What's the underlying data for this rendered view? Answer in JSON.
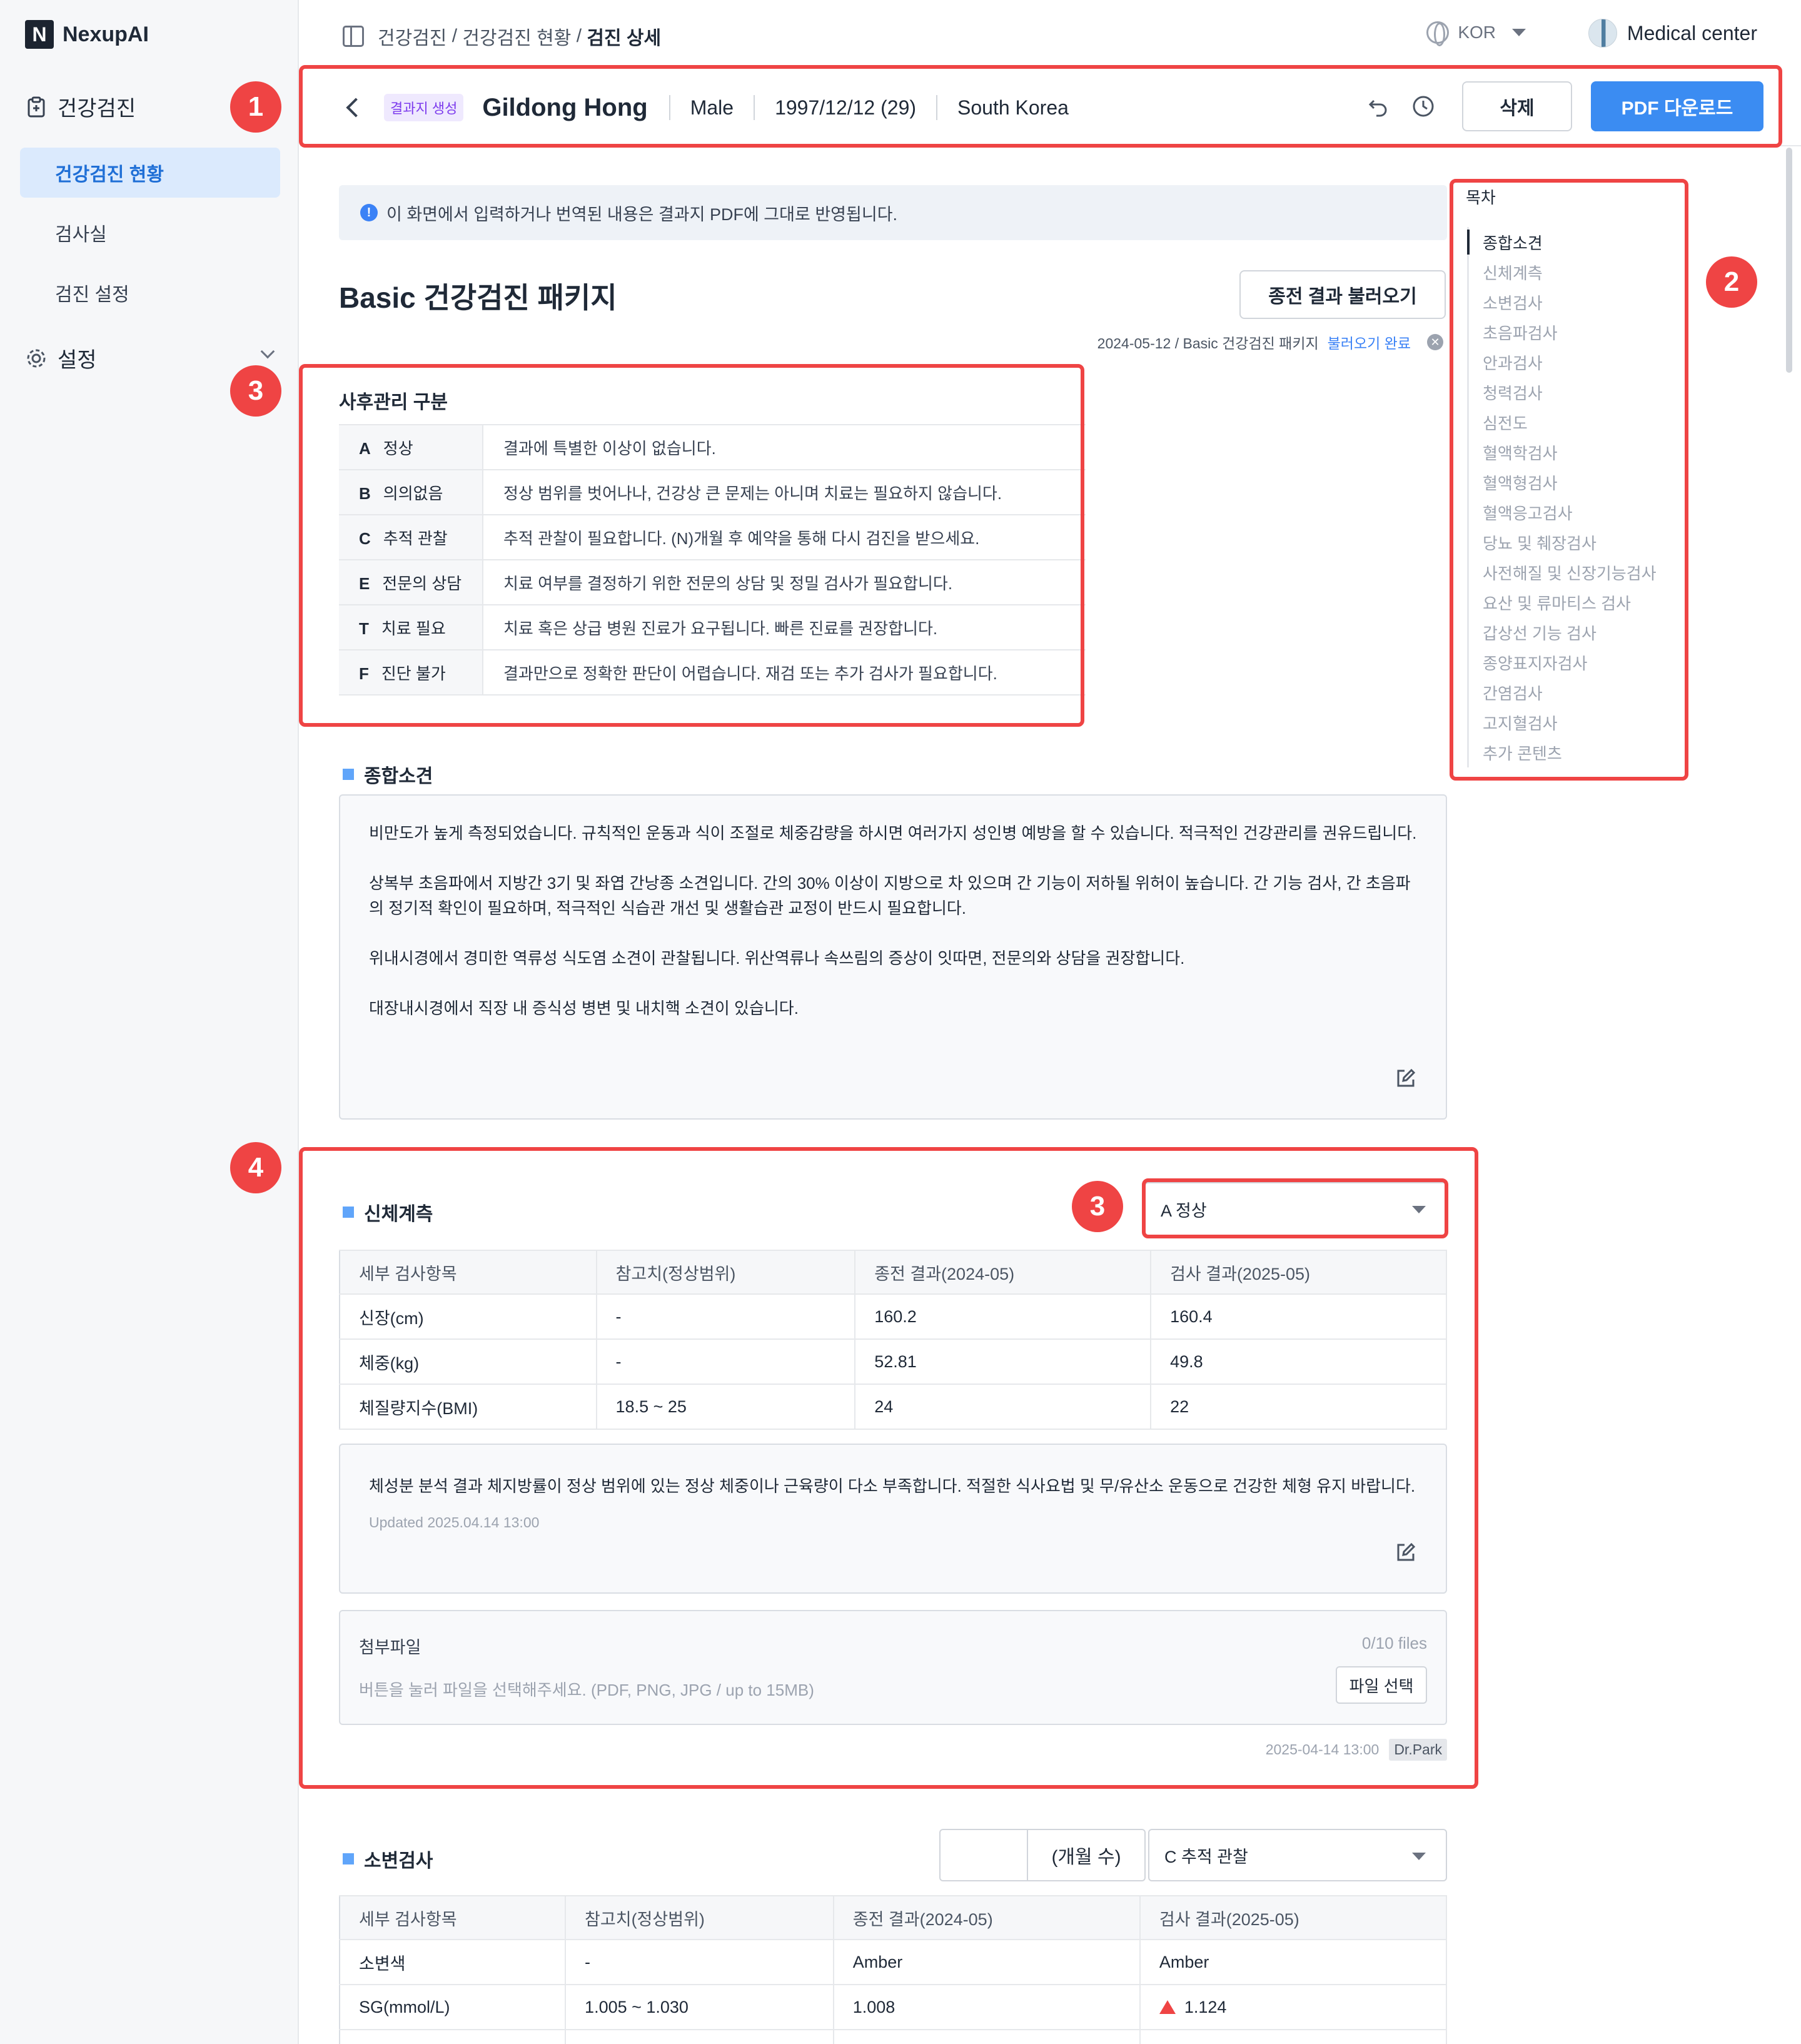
{
  "app": {
    "brand": "NexupAI",
    "brand_logo": "N"
  },
  "sidebar": {
    "group_health": "건강검진",
    "items": [
      {
        "label": "건강검진 현황",
        "active": true
      },
      {
        "label": "검사실"
      },
      {
        "label": "검진 설정"
      }
    ],
    "group_settings": "설정"
  },
  "topbar": {
    "breadcrumb": [
      "건강검진",
      "건강검진 현황",
      "검진 상세"
    ],
    "breadcrumb_sep": " / ",
    "language": "KOR",
    "center_name": "Medical center"
  },
  "patient": {
    "status_badge": "결과지 생성",
    "name": "Gildong Hong",
    "gender": "Male",
    "birth": "1997/12/12 (29)",
    "country": "South Korea",
    "delete_label": "삭제",
    "pdf_label": "PDF 다운로드"
  },
  "notice": "이 화면에서 입력하거나 번역된 내용은 결과지 PDF에 그대로 반영됩니다.",
  "package": {
    "title": "Basic 건강검진 패키지",
    "load_prev_label": "종전 결과 불러오기",
    "prev_meta": "2024-05-12 / Basic 건강검진 패키지",
    "prev_status": "불러오기 완료"
  },
  "legend": {
    "title": "사후관리 구분",
    "rows": [
      {
        "code": "A",
        "label": "정상",
        "desc": "결과에 특별한 이상이 없습니다."
      },
      {
        "code": "B",
        "label": "의의없음",
        "desc": "정상 범위를 벗어나나, 건강상 큰 문제는 아니며 치료는 필요하지 않습니다."
      },
      {
        "code": "C",
        "label": "추적 관찰",
        "desc": "추적 관찰이 필요합니다. (N)개월 후 예약을 통해 다시 검진을 받으세요."
      },
      {
        "code": "E",
        "label": "전문의 상담",
        "desc": "치료 여부를 결정하기 위한 전문의 상담 및 정밀 검사가 필요합니다."
      },
      {
        "code": "T",
        "label": "치료 필요",
        "desc": "치료 혹은 상급 병원 진료가 요구됩니다. 빠른 진료를 권장합니다."
      },
      {
        "code": "F",
        "label": "진단 불가",
        "desc": "결과만으로 정확한 판단이 어렵습니다. 재검 또는 추가 검사가 필요합니다."
      }
    ]
  },
  "summary": {
    "title": "종합소견",
    "paragraphs": [
      "비만도가 높게 측정되었습니다. 규칙적인 운동과 식이 조절로 체중감량을 하시면 여러가지 성인병 예방을 할 수 있습니다. 적극적인 건강관리를 권유드립니다.",
      "상복부 초음파에서 지방간 3기 및 좌엽 간낭종 소견입니다. 간의 30% 이상이 지방으로 차 있으며 간 기능이 저하될 위허이 높습니다. 간 기능 검사, 간 초음파의 정기적 확인이 필요하며, 적극적인 식습관 개선 및 생활습관 교정이 반드시 필요합니다.",
      "위내시경에서 경미한 역류성 식도염 소견이 관찰됩니다. 위산역류나 속쓰림의 증상이 잇따면, 전문의와 상담을 권장합니다.",
      "대장내시경에서 직장 내 증식성 병변 및 내치핵 소견이 있습니다."
    ]
  },
  "table_headers": [
    "세부 검사항목",
    "참고치(정상범위)",
    "종전 결과(2024-05)",
    "검사 결과(2025-05)"
  ],
  "body_measure": {
    "title": "신체계측",
    "grade": "A 정상",
    "rows": [
      [
        "신장(cm)",
        "-",
        "160.2",
        "160.4"
      ],
      [
        "체중(kg)",
        "-",
        "52.81",
        "49.8"
      ],
      [
        "체질량지수(BMI)",
        "18.5 ~ 25",
        "24",
        "22"
      ]
    ],
    "comment": "체성분 분석 결과 체지방률이 정상 범위에 있는 정상 체중이나 근육량이 다소 부족합니다. 적절한 식사요법 및 무/유산소 운동으로 건강한 체형 유지 바랍니다.",
    "updated": "Updated 2025.04.14 13:00",
    "attach_title": "첨부파일",
    "attach_count": "0/10 files",
    "attach_hint": "버튼을 눌러 파일을 선택해주세요. (PDF, PNG, JPG / up to 15MB)",
    "attach_button": "파일 선택",
    "signed_time": "2025-04-14 13:00",
    "signed_by": "Dr.Park"
  },
  "urine": {
    "title": "소변검사",
    "months_unit": "(개월 수)",
    "grade": "C 추적 관찰",
    "rows": [
      [
        "소변색",
        "-",
        "Amber",
        "Amber"
      ],
      [
        "SG(mmol/L)",
        "1.005 ~ 1.030",
        "1.008",
        "1.124"
      ]
    ]
  },
  "toc": {
    "title": "목차",
    "items": [
      "종합소견",
      "신체계측",
      "소변검사",
      "초음파검사",
      "안과검사",
      "청력검사",
      "심전도",
      "혈액학검사",
      "혈액형검사",
      "혈액응고검사",
      "당뇨 및 췌장검사",
      "사전해질 및 신장기능검사",
      "요산 및 류마티스 검사",
      "갑상선 기능 검사",
      "종양표지자검사",
      "간염검사",
      "고지혈검사",
      "추가 콘텐츠"
    ]
  },
  "annotations": [
    "1",
    "2",
    "3",
    "3",
    "4"
  ],
  "colors": {
    "primary": "#3b8cf2",
    "annotation": "#ef4444",
    "active_nav_bg": "#dbeafd",
    "abnormal": "#ef4444"
  }
}
